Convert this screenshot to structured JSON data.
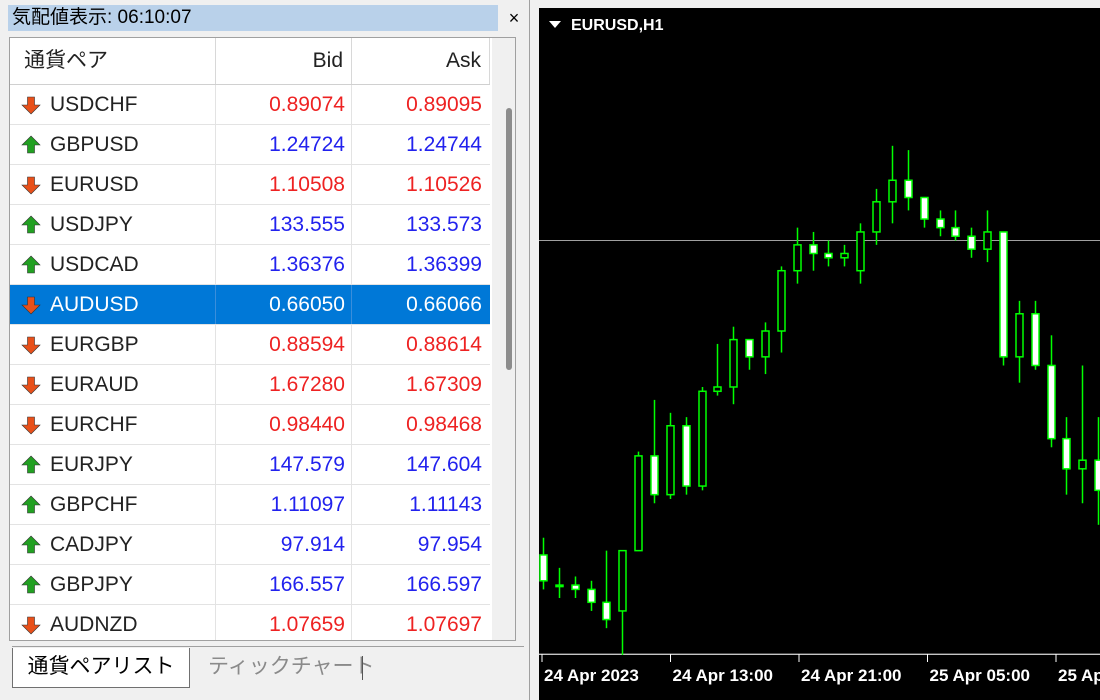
{
  "market_watch": {
    "title": "気配値表示: 06:10:07",
    "close_glyph": "×",
    "columns": {
      "symbol": "通貨ペア",
      "bid": "Bid",
      "ask": "Ask"
    },
    "up_color": "#2222ee",
    "down_color": "#ee2222",
    "up_icon_color": "#22a022",
    "down_icon_color": "#e8501a",
    "selected_color": "#0078d7",
    "rows": [
      {
        "symbol": "USDCHF",
        "bid": "0.89074",
        "ask": "0.89095",
        "direction": "down",
        "icon": "arrow-down-icon"
      },
      {
        "symbol": "GBPUSD",
        "bid": "1.24724",
        "ask": "1.24744",
        "direction": "up",
        "icon": "arrow-up-icon"
      },
      {
        "symbol": "EURUSD",
        "bid": "1.10508",
        "ask": "1.10526",
        "direction": "down",
        "icon": "arrow-down-icon"
      },
      {
        "symbol": "USDJPY",
        "bid": "133.555",
        "ask": "133.573",
        "direction": "up",
        "icon": "arrow-up-icon"
      },
      {
        "symbol": "USDCAD",
        "bid": "1.36376",
        "ask": "1.36399",
        "direction": "up",
        "icon": "arrow-up-icon"
      },
      {
        "symbol": "AUDUSD",
        "bid": "0.66050",
        "ask": "0.66066",
        "direction": "down",
        "icon": "arrow-down-icon",
        "selected": true
      },
      {
        "symbol": "EURGBP",
        "bid": "0.88594",
        "ask": "0.88614",
        "direction": "down",
        "icon": "arrow-down-icon"
      },
      {
        "symbol": "EURAUD",
        "bid": "1.67280",
        "ask": "1.67309",
        "direction": "down",
        "icon": "arrow-down-icon"
      },
      {
        "symbol": "EURCHF",
        "bid": "0.98440",
        "ask": "0.98468",
        "direction": "down",
        "icon": "arrow-down-icon"
      },
      {
        "symbol": "EURJPY",
        "bid": "147.579",
        "ask": "147.604",
        "direction": "up",
        "icon": "arrow-up-icon"
      },
      {
        "symbol": "GBPCHF",
        "bid": "1.11097",
        "ask": "1.11143",
        "direction": "up",
        "icon": "arrow-up-icon"
      },
      {
        "symbol": "CADJPY",
        "bid": "97.914",
        "ask": "97.954",
        "direction": "up",
        "icon": "arrow-up-icon"
      },
      {
        "symbol": "GBPJPY",
        "bid": "166.557",
        "ask": "166.597",
        "direction": "up",
        "icon": "arrow-up-icon"
      },
      {
        "symbol": "AUDNZD",
        "bid": "1.07659",
        "ask": "1.07697",
        "direction": "down",
        "icon": "arrow-down-icon"
      }
    ],
    "tabs": [
      {
        "label": "通貨ペアリスト",
        "active": true
      },
      {
        "label": "ティックチャート",
        "active": false
      }
    ]
  },
  "chart": {
    "title": "EURUSD,H1",
    "menu_icon": "triangle-down-icon",
    "background_color": "#000000",
    "candle_color": "#00ff00",
    "bull_body_color": "#000000",
    "bear_body_color": "#ffffff",
    "text_color": "#ffffff",
    "x_labels": [
      "24 Apr 2023",
      "24 Apr 13:00",
      "24 Apr 21:00",
      "25 Apr 05:00",
      "25 Ap"
    ],
    "price_line": 1.1051
  },
  "chart_data": {
    "type": "candlestick",
    "title": "EURUSD,H1",
    "x_tick_labels": [
      "24 Apr 2023",
      "24 Apr 13:00",
      "24 Apr 21:00",
      "25 Apr 05:00",
      "25 Ap"
    ],
    "ylim": [
      1.0955,
      1.1105
    ],
    "grid": false,
    "ohlc": [
      {
        "o": 1.0978,
        "h": 1.0982,
        "l": 1.097,
        "c": 1.0972
      },
      {
        "o": 1.0971,
        "h": 1.0975,
        "l": 1.0968,
        "c": 1.0971
      },
      {
        "o": 1.0971,
        "h": 1.0973,
        "l": 1.0968,
        "c": 1.097
      },
      {
        "o": 1.097,
        "h": 1.0972,
        "l": 1.0965,
        "c": 1.0967
      },
      {
        "o": 1.0967,
        "h": 1.0979,
        "l": 1.0961,
        "c": 1.0963
      },
      {
        "o": 1.0965,
        "h": 1.0972,
        "l": 1.0953,
        "c": 1.0979
      },
      {
        "o": 1.0979,
        "h": 1.1002,
        "l": 1.0979,
        "c": 1.1001
      },
      {
        "o": 1.1001,
        "h": 1.1014,
        "l": 1.099,
        "c": 1.0992
      },
      {
        "o": 1.0992,
        "h": 1.1011,
        "l": 1.0991,
        "c": 1.1008
      },
      {
        "o": 1.1008,
        "h": 1.101,
        "l": 1.0992,
        "c": 1.0994
      },
      {
        "o": 1.0994,
        "h": 1.1017,
        "l": 1.0993,
        "c": 1.1016
      },
      {
        "o": 1.1016,
        "h": 1.1027,
        "l": 1.1015,
        "c": 1.1017
      },
      {
        "o": 1.1017,
        "h": 1.1031,
        "l": 1.1013,
        "c": 1.1028
      },
      {
        "o": 1.1028,
        "h": 1.1028,
        "l": 1.1021,
        "c": 1.1024
      },
      {
        "o": 1.1024,
        "h": 1.1032,
        "l": 1.102,
        "c": 1.103
      },
      {
        "o": 1.103,
        "h": 1.1045,
        "l": 1.1025,
        "c": 1.1044
      },
      {
        "o": 1.1044,
        "h": 1.1054,
        "l": 1.1041,
        "c": 1.105
      },
      {
        "o": 1.105,
        "h": 1.1053,
        "l": 1.1044,
        "c": 1.1048
      },
      {
        "o": 1.1048,
        "h": 1.1051,
        "l": 1.1045,
        "c": 1.1047
      },
      {
        "o": 1.1047,
        "h": 1.105,
        "l": 1.1045,
        "c": 1.1048
      },
      {
        "o": 1.1044,
        "h": 1.1055,
        "l": 1.1041,
        "c": 1.1053
      },
      {
        "o": 1.1053,
        "h": 1.1063,
        "l": 1.105,
        "c": 1.106
      },
      {
        "o": 1.106,
        "h": 1.1073,
        "l": 1.1055,
        "c": 1.1065
      },
      {
        "o": 1.1065,
        "h": 1.1072,
        "l": 1.1058,
        "c": 1.1061
      },
      {
        "o": 1.1061,
        "h": 1.1061,
        "l": 1.1054,
        "c": 1.1056
      },
      {
        "o": 1.1056,
        "h": 1.1058,
        "l": 1.1052,
        "c": 1.1054
      },
      {
        "o": 1.1054,
        "h": 1.1058,
        "l": 1.1051,
        "c": 1.1052
      },
      {
        "o": 1.1052,
        "h": 1.1054,
        "l": 1.1047,
        "c": 1.1049
      },
      {
        "o": 1.1049,
        "h": 1.1058,
        "l": 1.1046,
        "c": 1.1053
      },
      {
        "o": 1.1053,
        "h": 1.1053,
        "l": 1.1022,
        "c": 1.1024
      },
      {
        "o": 1.1024,
        "h": 1.1037,
        "l": 1.1018,
        "c": 1.1034
      },
      {
        "o": 1.1034,
        "h": 1.1037,
        "l": 1.1021,
        "c": 1.1022
      },
      {
        "o": 1.1022,
        "h": 1.1029,
        "l": 1.1003,
        "c": 1.1005
      },
      {
        "o": 1.1005,
        "h": 1.101,
        "l": 1.0992,
        "c": 1.0998
      },
      {
        "o": 1.0998,
        "h": 1.1022,
        "l": 1.099,
        "c": 1.1
      },
      {
        "o": 1.1,
        "h": 1.101,
        "l": 1.0985,
        "c": 1.0993
      }
    ],
    "price_line": 1.1051
  }
}
